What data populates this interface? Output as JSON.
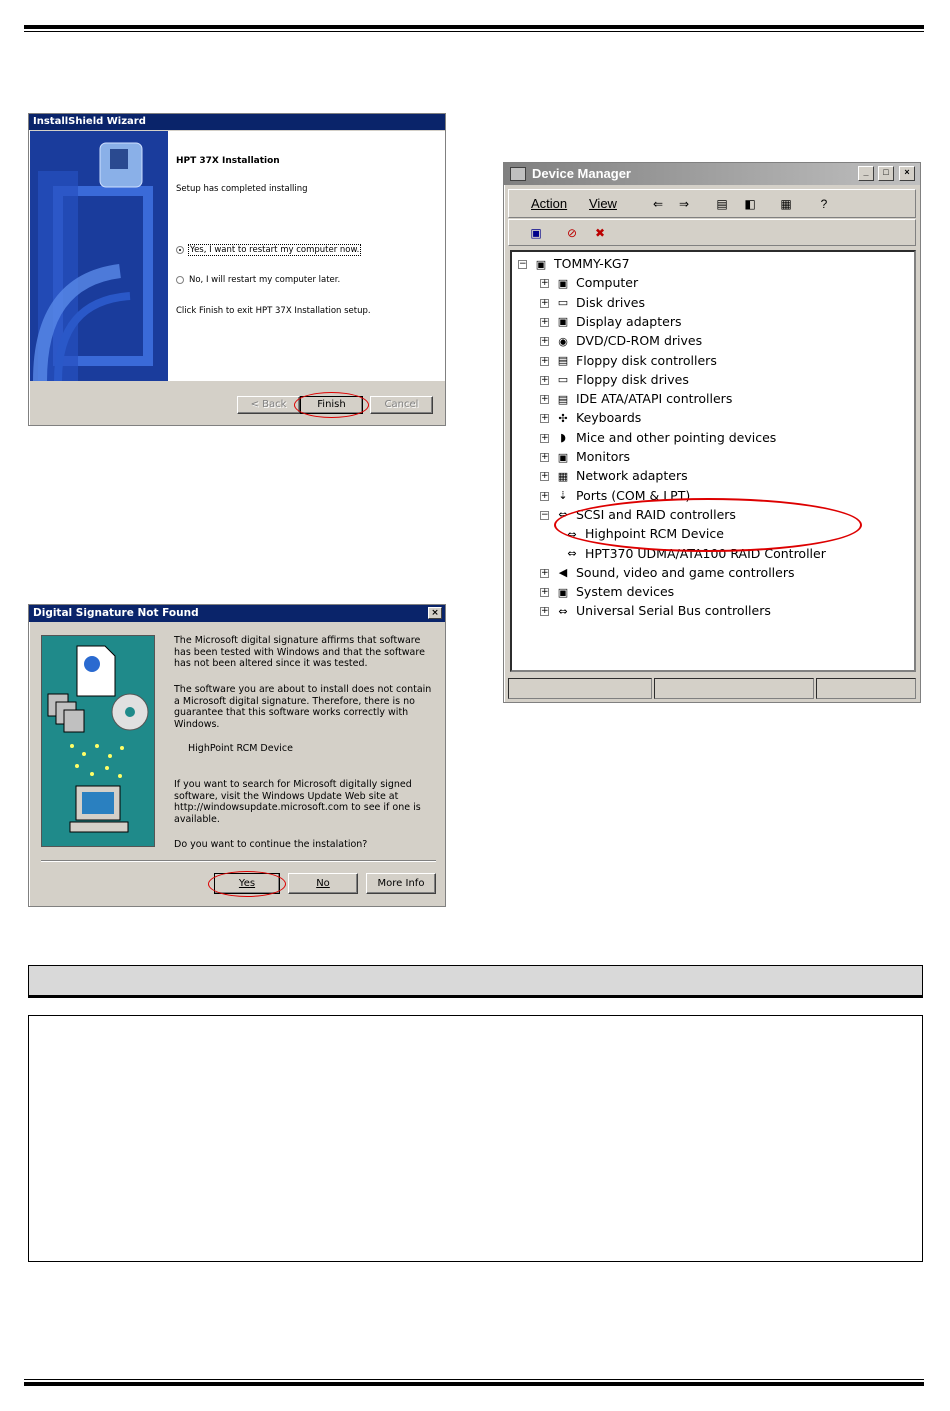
{
  "wizard": {
    "title": "InstallShield Wizard",
    "heading": "HPT 37X Installation",
    "status": "Setup has completed installing",
    "option_restart_now": "Yes, I want to restart my computer now.",
    "option_restart_later": "No, I will restart my computer later.",
    "instruction": "Click Finish to exit HPT 37X Installation setup.",
    "back_button": "< Back",
    "finish_button": "Finish",
    "cancel_button": "Cancel"
  },
  "digsig": {
    "title": "Digital Signature Not Found",
    "close_glyph": "×",
    "paragraph1": "The Microsoft digital signature affirms that software has been tested with Windows and that the software has not been altered since it was tested.",
    "paragraph2": "The software you are about to install does not contain a Microsoft digital signature. Therefore,  there is no guarantee that this software works correctly with Windows.",
    "device_name": "HighPoint RCM Device",
    "paragraph3": "If you want to search for Microsoft digitally signed software, visit the Windows Update Web site at http://windowsupdate.microsoft.com to see if one is available.",
    "question": "Do you want to continue the instalation?",
    "yes_button": "Yes",
    "no_button": "No",
    "more_info_button": "More Info"
  },
  "devmgr": {
    "title": "Device Manager",
    "menu_action": "Action",
    "menu_view": "View",
    "root": "TOMMY-KG7",
    "nodes": [
      "Computer",
      "Disk drives",
      "Display adapters",
      "DVD/CD-ROM drives",
      "Floppy disk controllers",
      "Floppy disk drives",
      "IDE ATA/ATAPI controllers",
      "Keyboards",
      "Mice and other pointing devices",
      "Monitors",
      "Network adapters",
      "Ports (COM & LPT)",
      "SCSI and RAID controllers",
      "Highpoint RCM Device",
      "HPT370 UDMA/ATA100 RAID Controller",
      "Sound, video and game controllers",
      "System devices",
      "Universal Serial Bus controllers"
    ]
  },
  "colors": {
    "highlight_oval": "#dd0000",
    "title_bar_active": "#0a246a",
    "wizard_art": "#1a3c9c",
    "digsig_art": "#1f8a8a"
  }
}
